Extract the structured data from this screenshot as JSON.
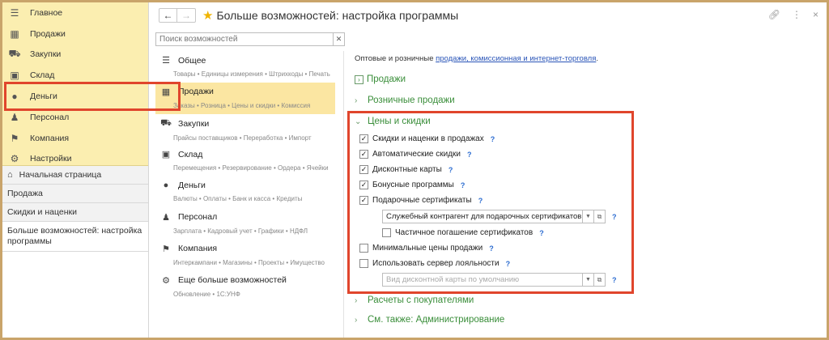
{
  "sidebar": {
    "sections": [
      {
        "label": "Главное",
        "icon": "menu-lines-icon"
      },
      {
        "label": "Продажи",
        "icon": "cash-register-icon"
      },
      {
        "label": "Закупки",
        "icon": "cart-icon"
      },
      {
        "label": "Склад",
        "icon": "warehouse-icon"
      },
      {
        "label": "Деньги",
        "icon": "coin-icon"
      },
      {
        "label": "Персонал",
        "icon": "person-icon"
      },
      {
        "label": "Компания",
        "icon": "flag-icon"
      },
      {
        "label": "Настройки",
        "icon": "gear-icon"
      }
    ],
    "open_windows": [
      {
        "label": "Начальная страница"
      },
      {
        "label": "Продажа"
      },
      {
        "label": "Скидки и наценки"
      },
      {
        "label": "Больше возможностей: настройка программы"
      }
    ]
  },
  "header": {
    "title": "Больше возможностей: настройка программы"
  },
  "search": {
    "placeholder": "Поиск возможностей"
  },
  "middle": {
    "items": [
      {
        "label": "Общее",
        "sub": "Товары • Единицы измерения • Штрихкоды • Печать"
      },
      {
        "label": "Продажи",
        "sub": "Заказы • Розница • Цены и скидки • Комиссия"
      },
      {
        "label": "Закупки",
        "sub": "Прайсы поставщиков • Переработка • Импорт"
      },
      {
        "label": "Склад",
        "sub": "Перемещения • Резервирование • Ордера • Ячейки"
      },
      {
        "label": "Деньги",
        "sub": "Валюты • Оплаты • Банк и касса • Кредиты"
      },
      {
        "label": "Персонал",
        "sub": "Зарплата • Кадровый учет • Графики • НДФЛ"
      },
      {
        "label": "Компания",
        "sub": "Интеркампани • Магазины • Проекты • Имущество"
      },
      {
        "label": "Еще больше возможностей",
        "sub": "Обновление • 1С:УНФ"
      }
    ]
  },
  "right": {
    "intro_text": "Оптовые и розничные ",
    "intro_link": "продажи, комиссионная и интернет-торговля",
    "intro_end": ".",
    "groups": {
      "sales": "Продажи",
      "retail": "Розничные продажи",
      "prices": "Цены и скидки",
      "settlements": "Расчеты с покупателями",
      "see_also": "См. также: Администрирование"
    },
    "options": {
      "discounts_markups": "Скидки и наценки в продажах",
      "auto_discounts": "Автоматические скидки",
      "discount_cards": "Дисконтные карты",
      "bonus_programs": "Бонусные программы",
      "gift_certificates": "Подарочные сертификаты",
      "partial_redemption": "Частичное погашение сертификатов",
      "min_prices": "Минимальные цены продажи",
      "loyalty_server": "Использовать сервер лояльности"
    },
    "fields": {
      "service_counterparty": "Служебный контрагент для подарочных сертификатов",
      "default_card_type": "Вид дисконтной карты по умолчанию"
    },
    "help_mark": "?"
  }
}
